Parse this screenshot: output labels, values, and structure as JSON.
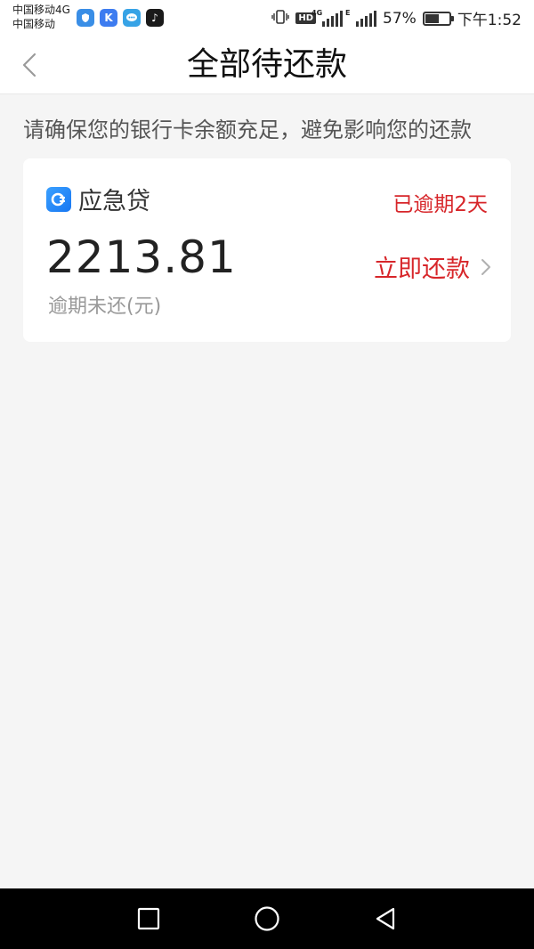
{
  "status_bar": {
    "carrier_1": "中国移动4G",
    "carrier_2": "中国移动",
    "network_type": "4G",
    "network_type_2": "E",
    "hd": "HD",
    "battery_percent": "57%",
    "battery_level": 0.57,
    "time": "下午1:52",
    "app_icons": [
      "shield-app-icon",
      "k-app-icon",
      "chat-app-icon",
      "tiktok-app-icon"
    ]
  },
  "header": {
    "title": "全部待还款"
  },
  "notice": {
    "text": "请确保您的银行卡余额充足，避免影响您的还款"
  },
  "loan": {
    "product_name": "应急贷",
    "overdue_status": "已逾期2天",
    "amount": "2213.81",
    "amount_label": "逾期未还(元)",
    "repay_label": "立即还款"
  },
  "colors": {
    "accent_red": "#d7262a",
    "background": "#f5f5f5",
    "card": "#ffffff"
  }
}
